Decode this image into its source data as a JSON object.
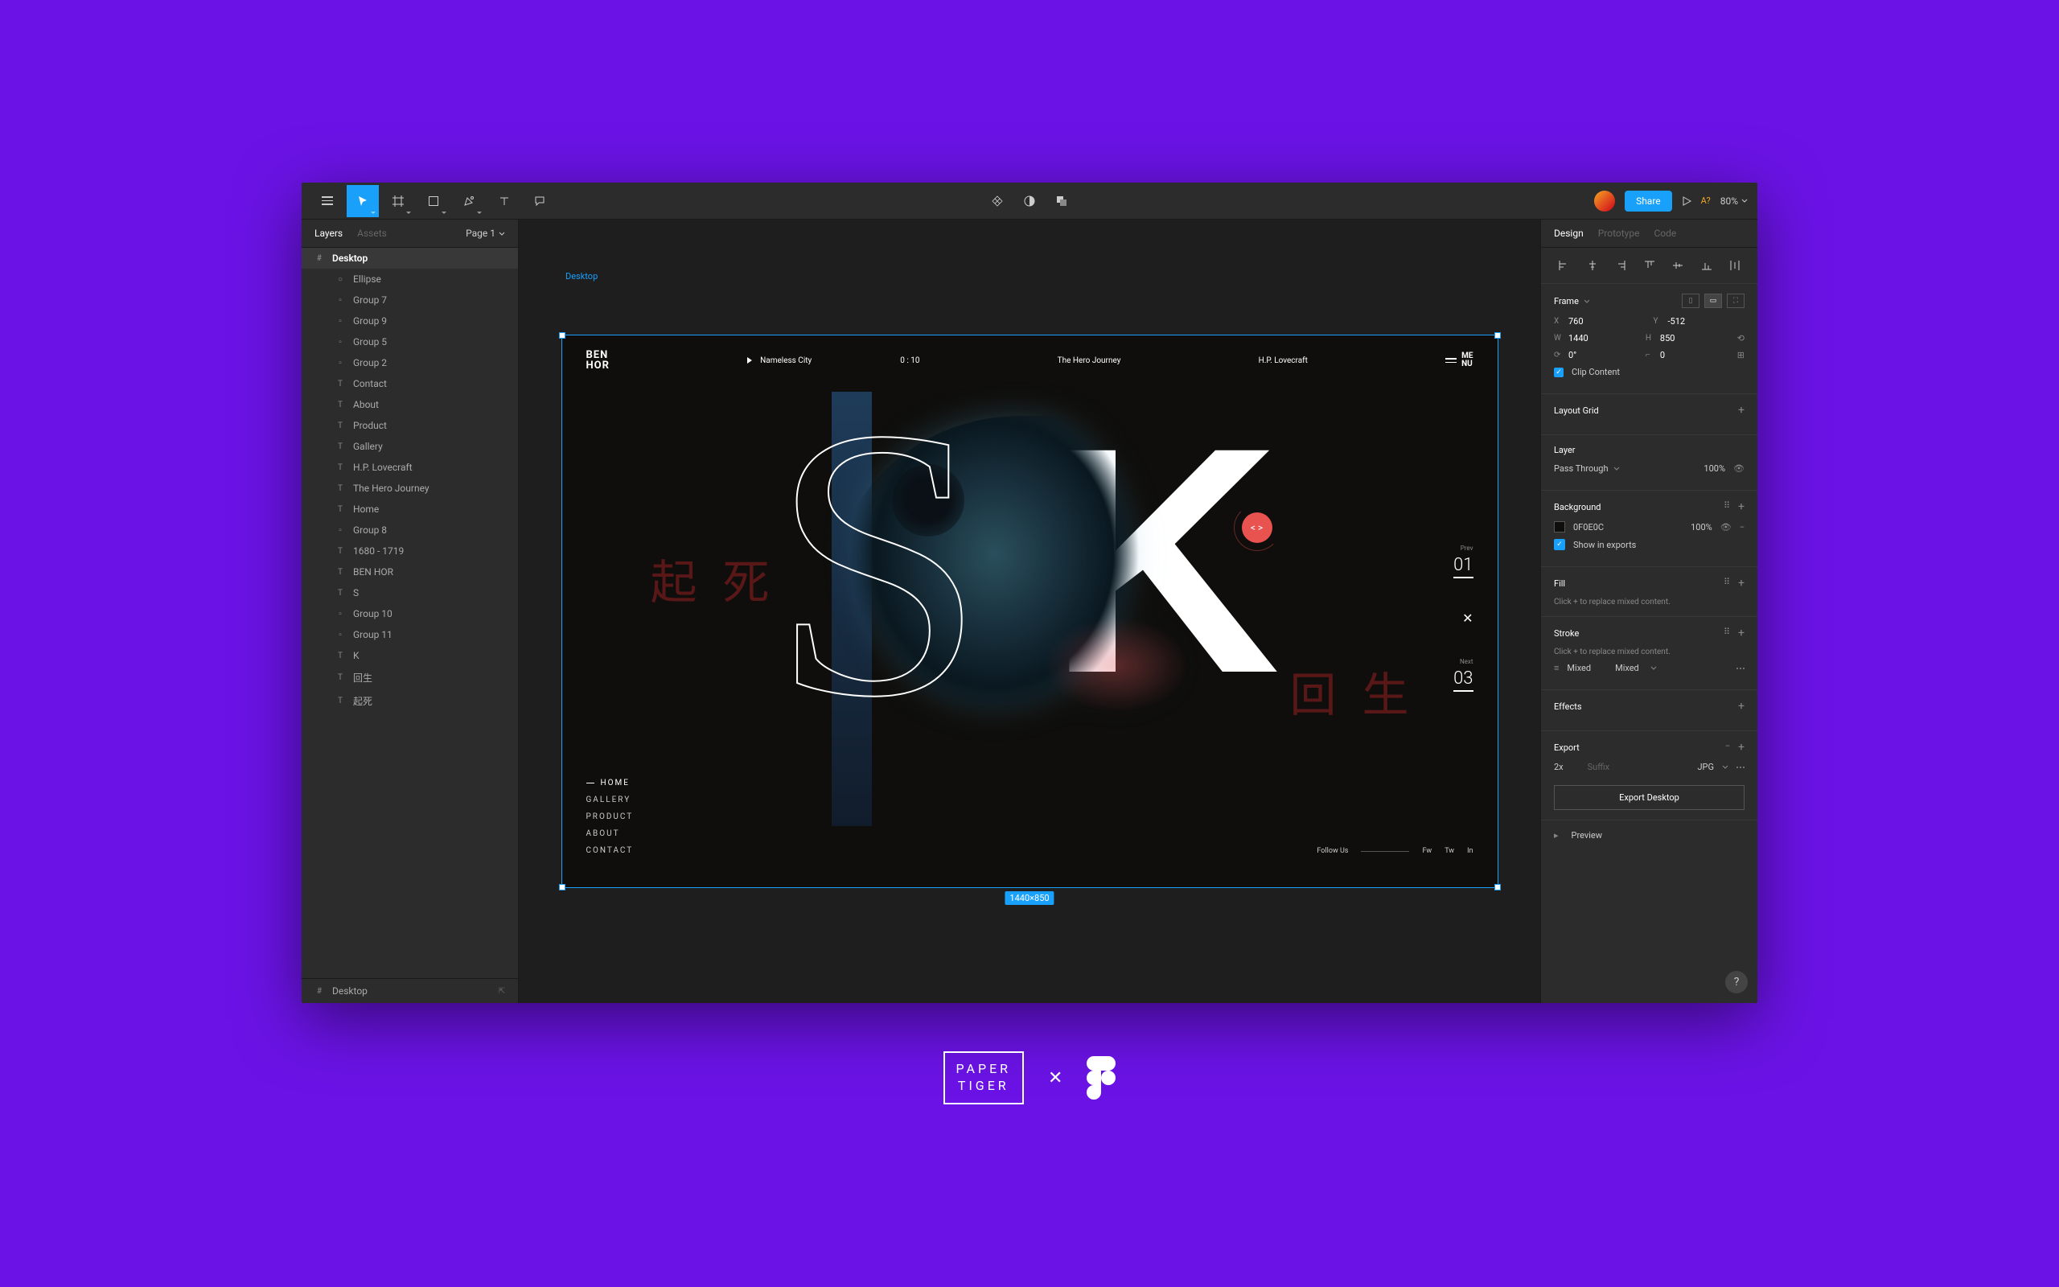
{
  "toolbar": {
    "share_label": "Share",
    "version_label": "A?",
    "zoom": "80%"
  },
  "left_panel": {
    "tabs": {
      "layers": "Layers",
      "assets": "Assets"
    },
    "page": "Page 1",
    "root": "Desktop",
    "layers": [
      {
        "icon": "ellipse",
        "name": "Ellipse"
      },
      {
        "icon": "group",
        "name": "Group 7"
      },
      {
        "icon": "group",
        "name": "Group 9"
      },
      {
        "icon": "group",
        "name": "Group 5"
      },
      {
        "icon": "group",
        "name": "Group 2"
      },
      {
        "icon": "text",
        "name": "Contact"
      },
      {
        "icon": "text",
        "name": "About"
      },
      {
        "icon": "text",
        "name": "Product"
      },
      {
        "icon": "text",
        "name": "Gallery"
      },
      {
        "icon": "text",
        "name": "H.P. Lovecraft"
      },
      {
        "icon": "text",
        "name": "The Hero Journey"
      },
      {
        "icon": "text",
        "name": "Home"
      },
      {
        "icon": "group",
        "name": "Group 8"
      },
      {
        "icon": "text",
        "name": "1680 - 1719"
      },
      {
        "icon": "text",
        "name": "BEN HOR"
      },
      {
        "icon": "text",
        "name": "S"
      },
      {
        "icon": "group",
        "name": "Group 10"
      },
      {
        "icon": "group",
        "name": "Group 11"
      },
      {
        "icon": "text",
        "name": "K"
      },
      {
        "icon": "text",
        "name": "回生"
      },
      {
        "icon": "text",
        "name": "起死"
      }
    ],
    "bottom": "Desktop"
  },
  "canvas": {
    "frame_label": "Desktop",
    "dimensions": "1440×850",
    "header": {
      "logo_l1": "BEN",
      "logo_l2": "HOR",
      "track": "Nameless City",
      "time": "0 : 10",
      "center": "The Hero Journey",
      "author": "H.P. Lovecraft",
      "menu_l1": "ME",
      "menu_l2": "NU"
    },
    "nav": [
      "HOME",
      "GALLERY",
      "PRODUCT",
      "ABOUT",
      "CONTACT"
    ],
    "pager": {
      "prev_label": "Prev",
      "prev": "01",
      "next_label": "Next",
      "next": "03"
    },
    "follow": {
      "label": "Follow Us",
      "fw": "Fw",
      "tw": "Tw",
      "in": "In"
    },
    "badge": "< >",
    "kanji": {
      "k1": "起",
      "k2": "死",
      "k3": "回",
      "k4": "生"
    },
    "letters": {
      "s": "S",
      "k": "K"
    }
  },
  "right_panel": {
    "tabs": {
      "design": "Design",
      "prototype": "Prototype",
      "code": "Code"
    },
    "frame": {
      "title": "Frame",
      "x_label": "X",
      "x": "760",
      "y_label": "Y",
      "y": "-512",
      "w_label": "W",
      "w": "1440",
      "h_label": "H",
      "h": "850",
      "rot": "0°",
      "rad": "0",
      "clip": "Clip Content"
    },
    "layout_grid": "Layout Grid",
    "layer": {
      "title": "Layer",
      "blend": "Pass Through",
      "opacity": "100%"
    },
    "background": {
      "title": "Background",
      "hex": "0F0E0C",
      "opacity": "100%",
      "show": "Show in exports"
    },
    "fill": {
      "title": "Fill",
      "hint": "Click + to replace mixed content."
    },
    "stroke": {
      "title": "Stroke",
      "hint": "Click + to replace mixed content.",
      "v1": "Mixed",
      "v2": "Mixed"
    },
    "effects": "Effects",
    "export": {
      "title": "Export",
      "scale": "2x",
      "suffix_label": "Suffix",
      "format": "JPG",
      "button": "Export Desktop"
    },
    "preview": "Preview"
  },
  "footer": {
    "paper_l1": "PAPER",
    "paper_l2": "TIGER",
    "x": "✕"
  }
}
